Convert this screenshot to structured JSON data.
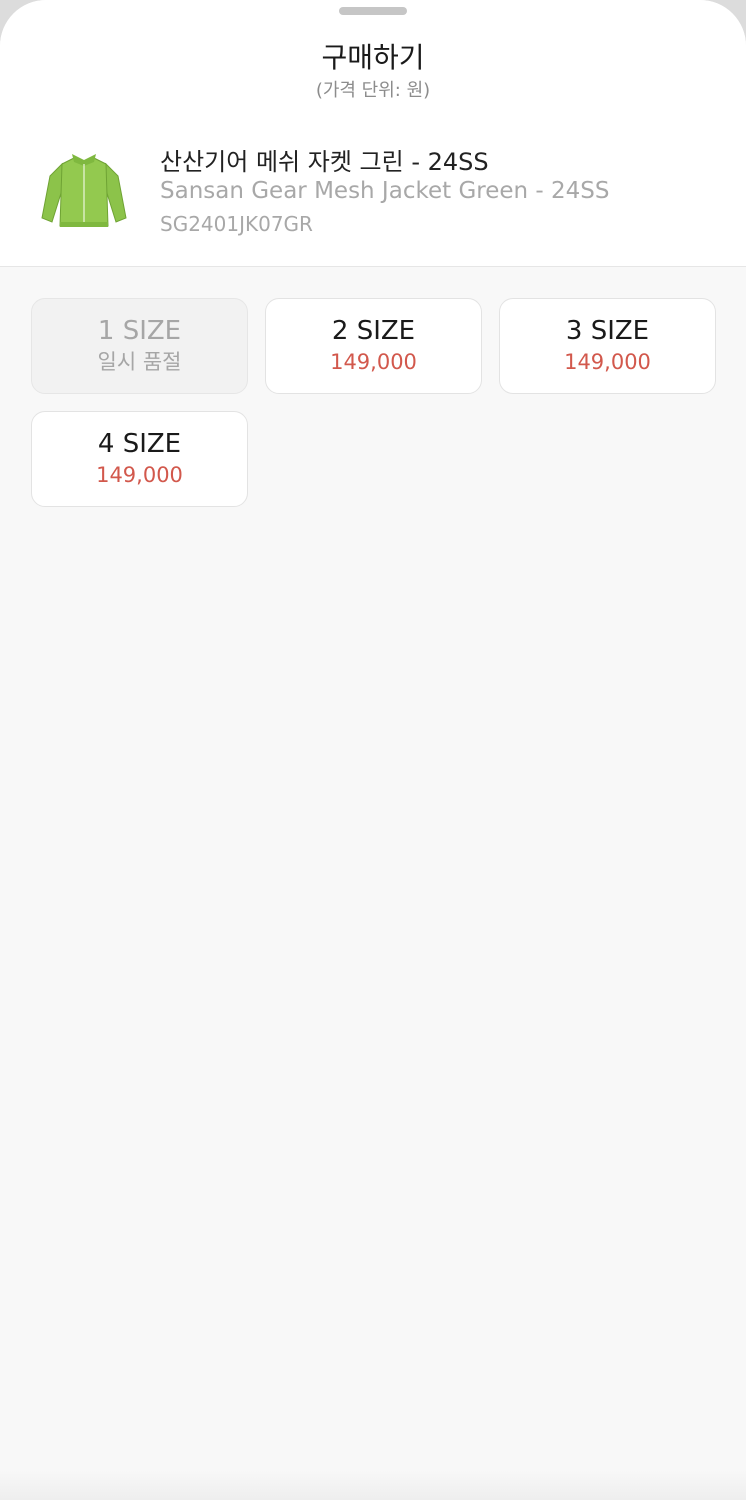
{
  "header": {
    "title": "구매하기",
    "subtitle": "(가격 단위: 원)"
  },
  "product": {
    "name_ko": "산산기어 메쉬 자켓 그린 - 24SS",
    "name_en": "Sansan Gear Mesh Jacket Green - 24SS",
    "sku": "SG2401JK07GR",
    "thumbnail_icon": "jacket-icon",
    "thumbnail_color": "#8cc34a"
  },
  "sizes": [
    {
      "label": "1 SIZE",
      "status": "일시 품절",
      "sold_out": true
    },
    {
      "label": "2 SIZE",
      "status": "149,000",
      "sold_out": false
    },
    {
      "label": "3 SIZE",
      "status": "149,000",
      "sold_out": false
    },
    {
      "label": "4 SIZE",
      "status": "149,000",
      "sold_out": false
    }
  ],
  "colors": {
    "price": "#d2584c",
    "muted": "#a6a6a6"
  }
}
